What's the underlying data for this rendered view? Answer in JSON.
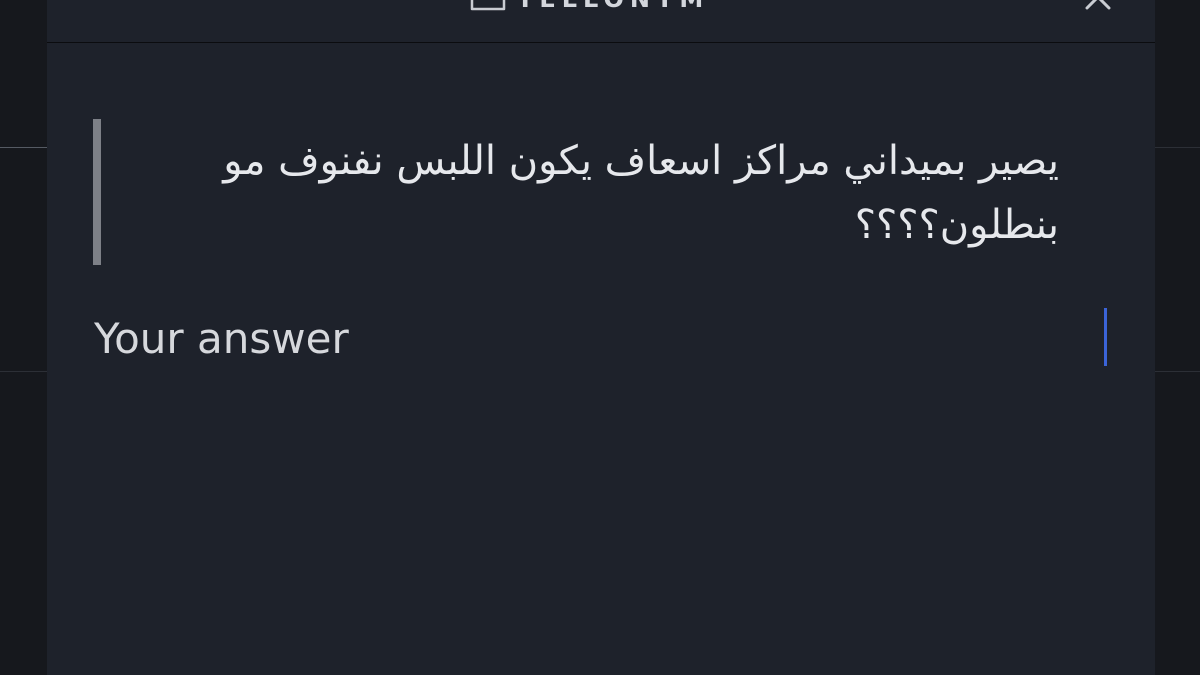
{
  "brand": {
    "name": "TELLONYM",
    "icon": "tellonym-logo-icon"
  },
  "header": {
    "close_icon": "close-icon"
  },
  "question": {
    "text": "يصير بميداني مراكز اسعاف يكون اللبس نفنوف مو بنطلون؟؟؟؟"
  },
  "answer": {
    "placeholder": "Your answer",
    "value": ""
  },
  "colors": {
    "modal_background": "#1e222b",
    "quote_bar": "#7d8087",
    "caret": "#3b64d8",
    "text": "#e6e8ec"
  }
}
